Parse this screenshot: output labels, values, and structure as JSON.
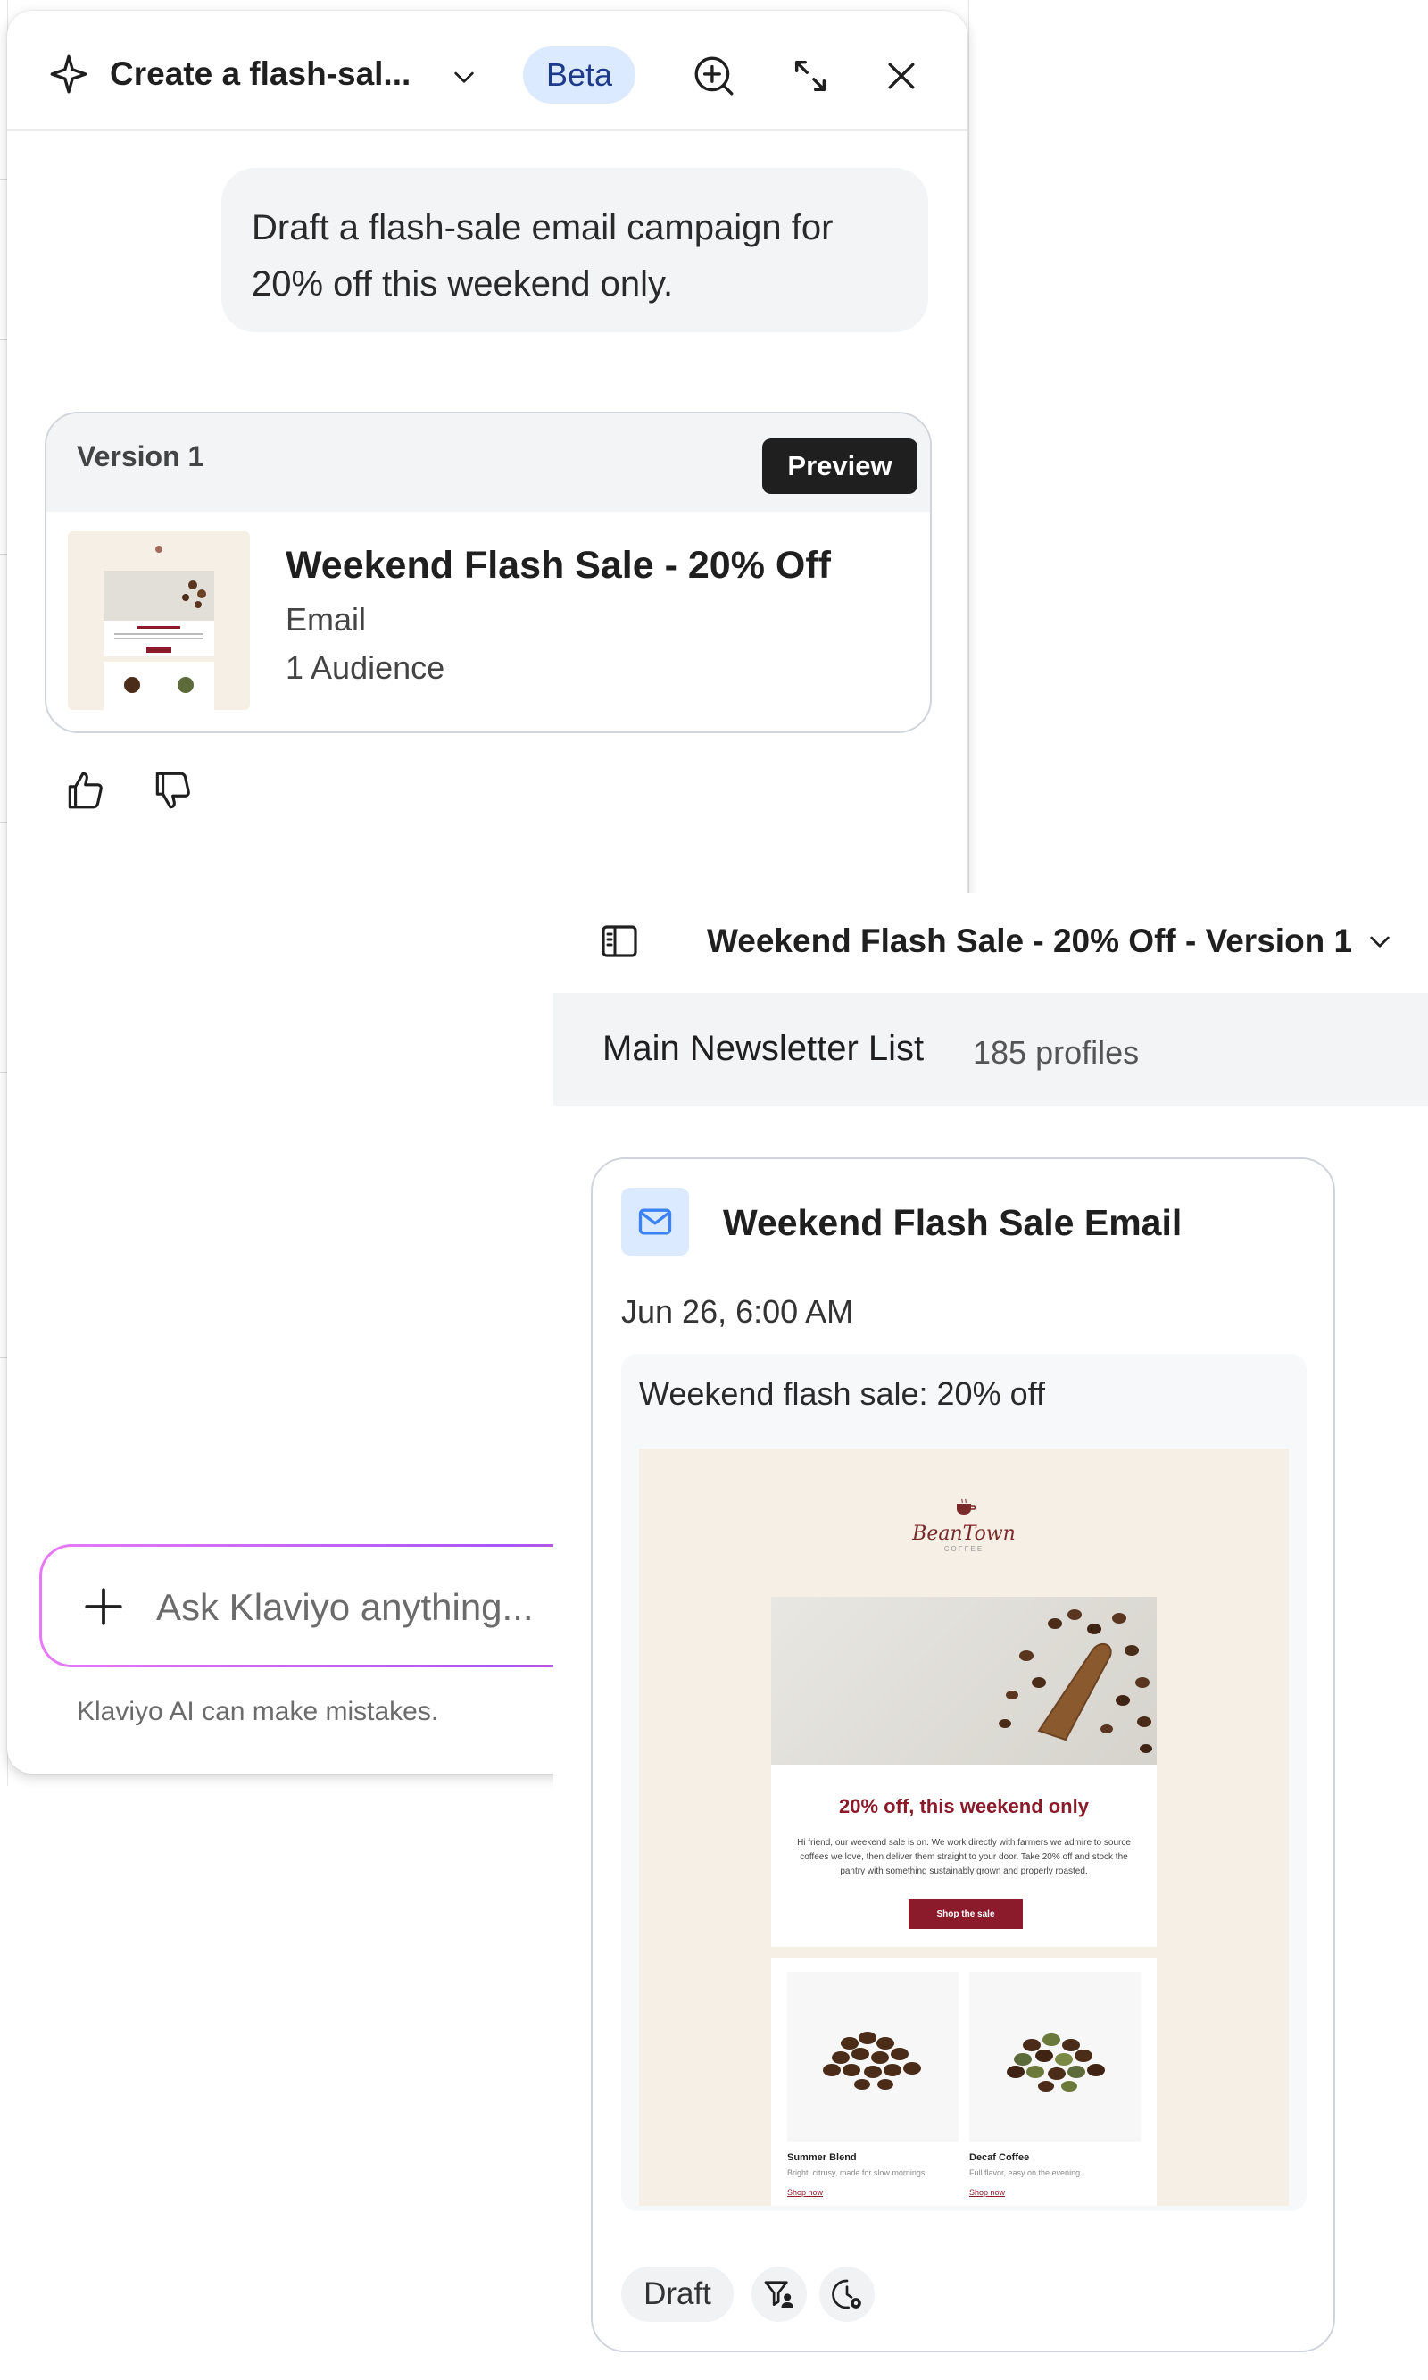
{
  "assistant": {
    "title": "Create a flash-sal...",
    "badge": "Beta",
    "user_message": "Draft a flash-sale email campaign for 20% off this weekend only.",
    "version_card": {
      "label": "Version 1",
      "preview_label": "Preview",
      "title": "Weekend Flash Sale - 20% Off",
      "type": "Email",
      "audience": "1 Audience"
    },
    "input_placeholder": "Ask Klaviyo anything...",
    "disclaimer": "Klaviyo AI can make mistakes."
  },
  "campaign": {
    "title": "Weekend Flash Sale - 20% Off - Version 1",
    "list_name": "Main Newsletter List",
    "list_count": "185 profiles",
    "email": {
      "title": "Weekend Flash Sale Email",
      "date": "Jun 26, 6:00 AM",
      "subject": "Weekend flash sale: 20% off",
      "status": "Draft",
      "preview": {
        "logo": "BeanTown",
        "logo_sub": "COFFEE",
        "headline": "20% off, this weekend only",
        "body": "Hi friend, our weekend sale is on. We work directly with farmers we admire to source coffees we love, then deliver them straight to your door. Take 20% off and stock the pantry with something sustainably grown and properly roasted.",
        "cta": "Shop the sale",
        "products": [
          {
            "name": "Summer Blend",
            "desc": "Bright, citrusy, made for slow mornings.",
            "link": "Shop now"
          },
          {
            "name": "Decaf Coffee",
            "desc": "Full flavor, easy on the evening.",
            "link": "Shop now"
          }
        ]
      }
    }
  },
  "colors": {
    "accent": "#8b1a2b",
    "beta_bg": "#dbeafe",
    "mail_icon": "#3b82f6"
  }
}
